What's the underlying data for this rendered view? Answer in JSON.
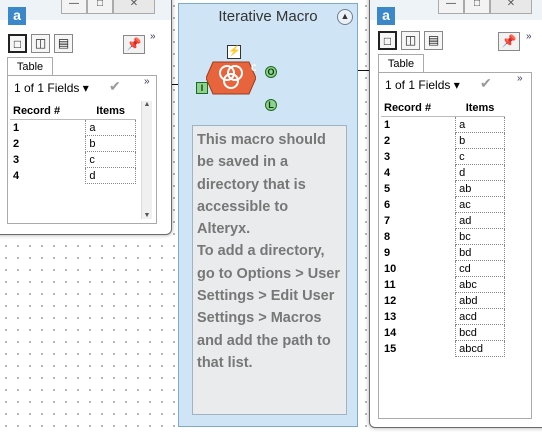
{
  "macro": {
    "title": "Iterative Macro",
    "collapse_icon": "chevron-up-icon",
    "comment": "This macro should be saved in a directory that is accessible to Alteryx.\nTo add a directory, go to Options > User Settings > Edit User Settings > Macros and add the path to that list.",
    "anchors": {
      "input": "I",
      "output": "O",
      "loop": "L",
      "tool": "C"
    }
  },
  "left_window": {
    "app_icon": "a",
    "tab": "Table",
    "fields_label": "1 of 1 Fields",
    "more": "»",
    "columns": [
      "Record #",
      "Items"
    ],
    "rows": [
      [
        "1",
        "a"
      ],
      [
        "2",
        "b"
      ],
      [
        "3",
        "c"
      ],
      [
        "4",
        "d"
      ]
    ]
  },
  "right_window": {
    "app_icon": "a",
    "tab": "Table",
    "fields_label": "1 of 1 Fields",
    "more": "»",
    "columns": [
      "Record #",
      "Items"
    ],
    "rows": [
      [
        "1",
        "a"
      ],
      [
        "2",
        "b"
      ],
      [
        "3",
        "c"
      ],
      [
        "4",
        "d"
      ],
      [
        "5",
        "ab"
      ],
      [
        "6",
        "ac"
      ],
      [
        "7",
        "ad"
      ],
      [
        "8",
        "bc"
      ],
      [
        "9",
        "bd"
      ],
      [
        "10",
        "cd"
      ],
      [
        "11",
        "abc"
      ],
      [
        "12",
        "abd"
      ],
      [
        "13",
        "acd"
      ],
      [
        "14",
        "bcd"
      ],
      [
        "15",
        "abcd"
      ]
    ]
  },
  "colors": {
    "container_bg": "#cfe5f5",
    "comment_text": "#777777",
    "tool_orange": "#e8643c",
    "anchor_green": "#8fd18f",
    "app_blue": "#3a87c9"
  }
}
